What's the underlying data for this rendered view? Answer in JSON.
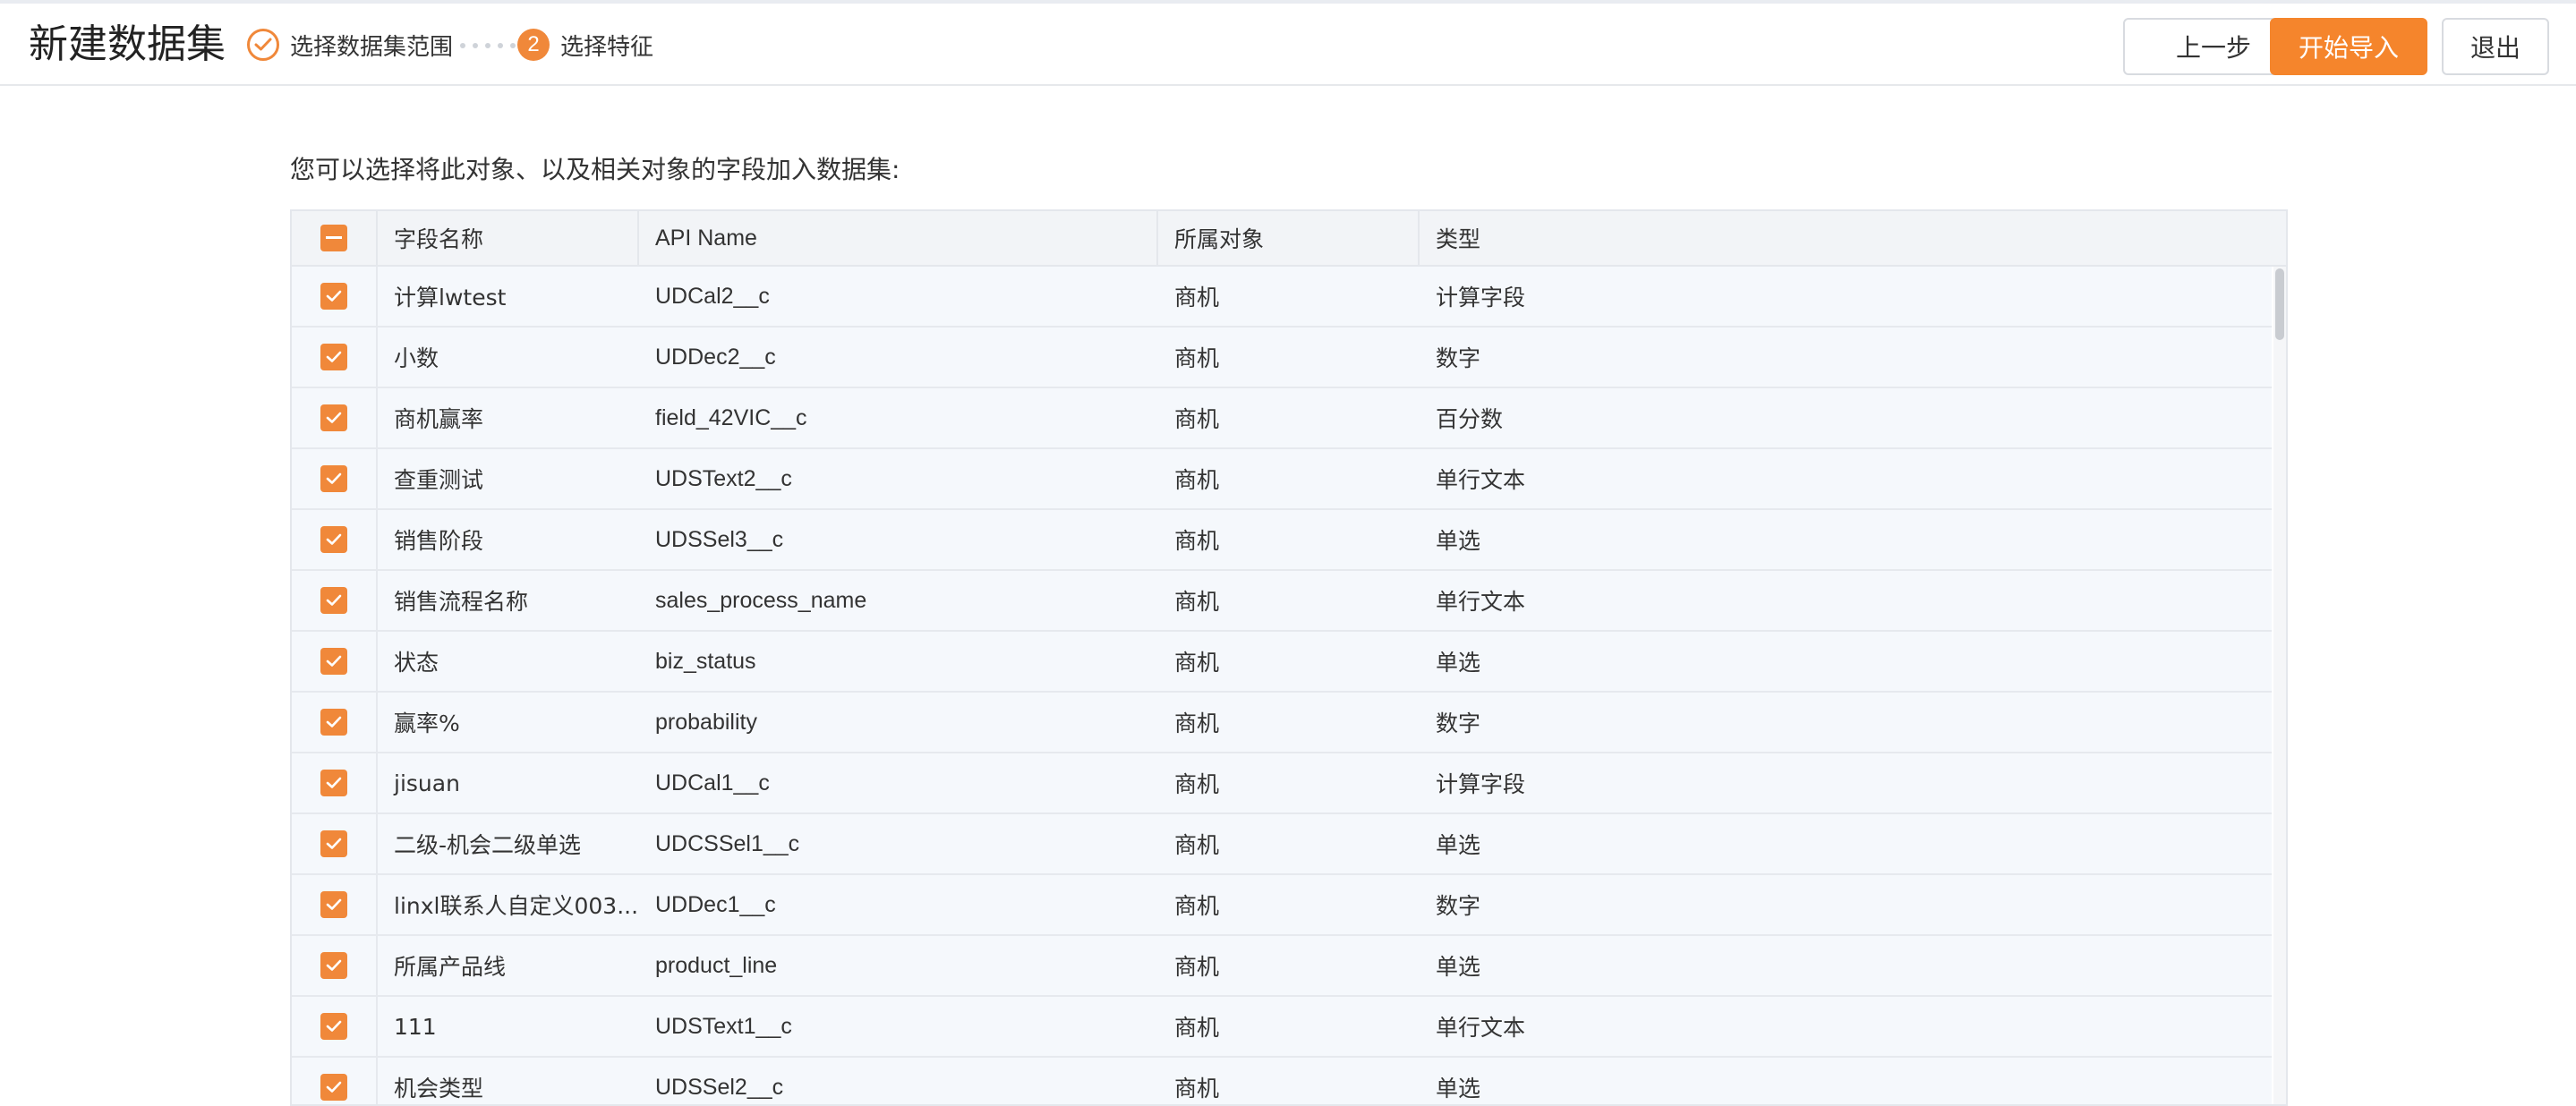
{
  "header": {
    "title": "新建数据集",
    "steps": [
      {
        "label": "选择数据集范围",
        "status": "done"
      },
      {
        "number": "2",
        "label": "选择特征",
        "status": "active"
      }
    ],
    "buttons": {
      "prev": "上一步",
      "start_import": "开始导入",
      "exit": "退出"
    }
  },
  "intro_text": "您可以选择将此对象、以及相关对象的字段加入数据集:",
  "table": {
    "columns": [
      "字段名称",
      "API Name",
      "所属对象",
      "类型"
    ],
    "select_all_state": "indeterminate",
    "rows": [
      {
        "name": "计算lwtest",
        "api": "UDCal2__c",
        "object": "商机",
        "type": "计算字段",
        "checked": true
      },
      {
        "name": "小数",
        "api": "UDDec2__c",
        "object": "商机",
        "type": "数字",
        "checked": true
      },
      {
        "name": "商机赢率",
        "api": "field_42VIC__c",
        "object": "商机",
        "type": "百分数",
        "checked": true
      },
      {
        "name": "查重测试",
        "api": "UDSText2__c",
        "object": "商机",
        "type": "单行文本",
        "checked": true
      },
      {
        "name": "销售阶段",
        "api": "UDSSel3__c",
        "object": "商机",
        "type": "单选",
        "checked": true
      },
      {
        "name": "销售流程名称",
        "api": "sales_process_name",
        "object": "商机",
        "type": "单行文本",
        "checked": true
      },
      {
        "name": "状态",
        "api": "biz_status",
        "object": "商机",
        "type": "单选",
        "checked": true
      },
      {
        "name": "赢率%",
        "api": "probability",
        "object": "商机",
        "type": "数字",
        "checked": true
      },
      {
        "name": "jisuan",
        "api": "UDCal1__c",
        "object": "商机",
        "type": "计算字段",
        "checked": true
      },
      {
        "name": "二级-机会二级单选",
        "api": "UDCSSel1__c",
        "object": "商机",
        "type": "单选",
        "checked": true
      },
      {
        "name": "linxl联系人自定义003...",
        "api": "UDDec1__c",
        "object": "商机",
        "type": "数字",
        "checked": true
      },
      {
        "name": "所属产品线",
        "api": "product_line",
        "object": "商机",
        "type": "单选",
        "checked": true
      },
      {
        "name": "111",
        "api": "UDSText1__c",
        "object": "商机",
        "type": "单行文本",
        "checked": true
      },
      {
        "name": "机会类型",
        "api": "UDSSel2__c",
        "object": "商机",
        "type": "单选",
        "checked": true
      }
    ]
  },
  "colors": {
    "accent": "#f5852c",
    "row_bg": "#f5f8fc",
    "header_bg": "#f2f4f7"
  }
}
